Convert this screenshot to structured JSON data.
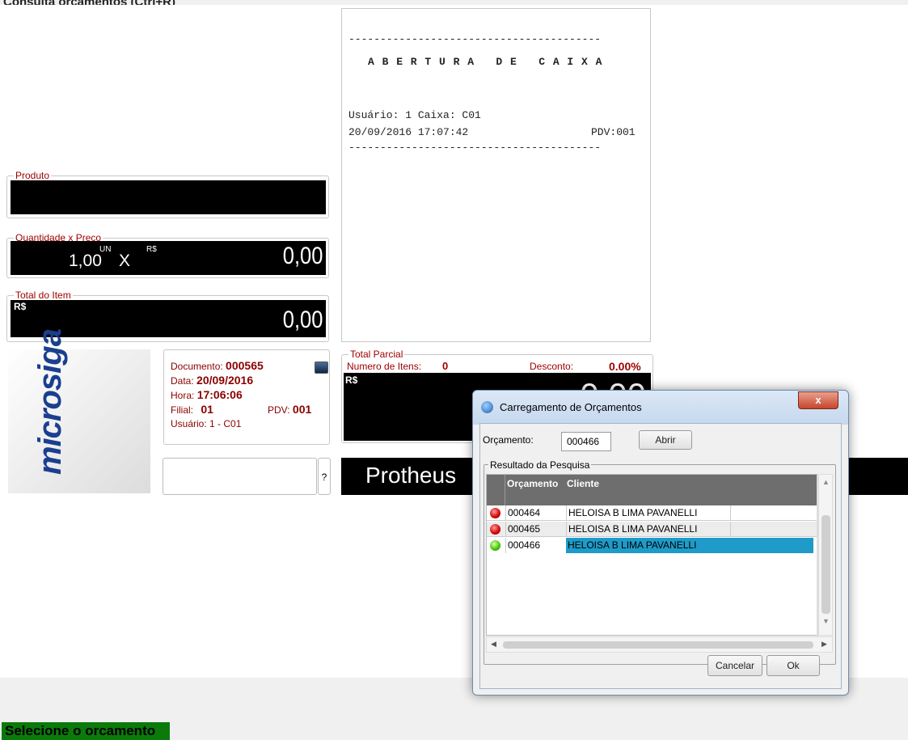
{
  "window": {
    "title": "Consulta orçamentos (Ctrl+R)"
  },
  "produto": {
    "legend": "Produto",
    "value": ""
  },
  "quantidade": {
    "legend": "Quantidade x Preço",
    "qty": "1,00",
    "unit": "UN",
    "x": "X",
    "currency": "R$",
    "price": "0,00"
  },
  "total_item": {
    "legend": "Total do Item",
    "currency": "R$",
    "value": "0,00"
  },
  "receipt": {
    "sep": "----------------------------------------",
    "heading": "A B E R T U R A   D E   C A I X A",
    "user_line": "Usuário: 1 Caixa: C01",
    "datetime": "20/09/2016 17:07:42",
    "pdv": "PDV:001"
  },
  "logo": {
    "text": "microsiga"
  },
  "document": {
    "doc_label": "Documento:",
    "doc_value": "000565",
    "date_label": "Data:",
    "date_value": "20/09/2016",
    "time_label": "Hora:",
    "time_value": "17:06:06",
    "filial_label": "Filial:",
    "filial_value": "01",
    "pdv_label": "PDV:",
    "pdv_value": "001",
    "user_label": "Usuário:",
    "user_value": "1 - C01"
  },
  "search": {
    "help": "?"
  },
  "total_parcial": {
    "legend": "Total Parcial",
    "itens_label": "Numero de Itens:",
    "itens_value": "0",
    "desconto_label": "Desconto:",
    "desconto_value": "0.00%",
    "currency": "R$",
    "value": "0,00"
  },
  "banner": {
    "text": "Protheus"
  },
  "dialog": {
    "title": "Carregamento de Orçamentos",
    "orcamento_label": "Orçamento:",
    "orcamento_value": "000466",
    "abrir": "Abrir",
    "group_legend": "Resultado da Pesquisa",
    "columns": [
      "Orçamento",
      "Cliente"
    ],
    "rows": [
      {
        "status": "red",
        "orcamento": "000464",
        "cliente": "HELOISA B LIMA PAVANELLI"
      },
      {
        "status": "red",
        "orcamento": "000465",
        "cliente": "HELOISA B LIMA PAVANELLI"
      },
      {
        "status": "green",
        "orcamento": "000466",
        "cliente": "HELOISA B LIMA PAVANELLI"
      }
    ],
    "cancelar": "Cancelar",
    "ok": "Ok"
  },
  "status": {
    "message": "Selecione o orcamento"
  },
  "colors": {
    "accent": "#a00000",
    "selected_row": "#1e9bc8",
    "status_green": "#0b7a0b"
  }
}
